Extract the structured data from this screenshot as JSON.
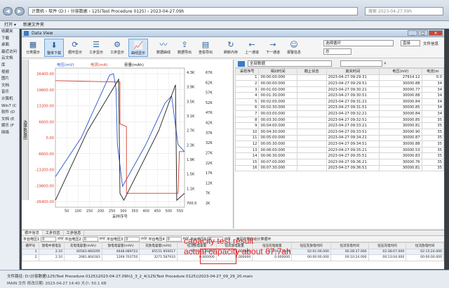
{
  "explorer": {
    "address": "计算机 › 软件 (D:) › 分容数据 › 125(Test Procedure 0125) › 2023-04-27.09h",
    "search_placeholder": "搜索 2023-04-27.09h",
    "menu": [
      "打开 ▾",
      "新建文件夹"
    ]
  },
  "sidebar": {
    "items": [
      "收藏夹",
      "下载",
      "桌面",
      "最近访问",
      "云文档",
      "库",
      "视频",
      "图片",
      "文档",
      "音乐",
      "计算机",
      "Win7 (C",
      "软件 (D",
      "文档 (E",
      "娱乐 (F",
      "网络"
    ]
  },
  "window": {
    "title": "Data View"
  },
  "toolbar": {
    "buttons": [
      {
        "label": "分类展示",
        "icon": "▦"
      },
      {
        "label": "整体下载",
        "icon": "⬇"
      },
      {
        "label": "循环显示",
        "icon": "⟳"
      },
      {
        "label": "工步显示",
        "icon": "☰"
      },
      {
        "label": "工序显示",
        "icon": "⚙"
      },
      {
        "label": "曲线显示",
        "icon": "📈"
      },
      {
        "label": "数据曲线",
        "icon": "〰"
      },
      {
        "label": "数据导出",
        "icon": "⇪"
      },
      {
        "label": "查看导出",
        "icon": "▤"
      },
      {
        "label": "刷新内存",
        "icon": "↻"
      },
      {
        "label": "上一通道",
        "icon": "←"
      },
      {
        "label": "下一通道",
        "icon": "→"
      },
      {
        "label": "报警信息",
        "icon": "☺"
      }
    ],
    "combo1": "选择循环",
    "combo2": "总",
    "combo3": "直接",
    "file_info": "文件信息"
  },
  "chart_data": {
    "type": "line",
    "legend_labels": [
      "电压(mV)",
      "电流(mA)",
      "容量(mAh)"
    ],
    "left_ticks_voltage": [
      "26400.00",
      "19800.00",
      "13200.00",
      "6600.00",
      "0.00",
      "-6600.00",
      "-13200.00",
      "-19800.00",
      "-26400.00"
    ],
    "right_ticks_capacity": [
      "4.3K",
      "3.9K",
      "3.5K",
      "3.1K",
      "2.7K",
      "2.3K",
      "1.9K",
      "1.5K",
      "1.1K",
      "700.0"
    ],
    "right_ticks_energy": [
      "67K",
      "62K",
      "57K",
      "52K",
      "47K",
      "42K",
      "37K",
      "32K",
      "27K",
      "22K",
      "17K",
      "12K",
      "7K",
      "2K"
    ],
    "x_ticks": [
      "50",
      "100",
      "150",
      "200",
      "250",
      "300",
      "350",
      "400",
      "450",
      "500",
      "550"
    ],
    "xlabel": "采样序号",
    "ylim": [
      -26400,
      26400
    ],
    "xlim": [
      0,
      570
    ]
  },
  "vertical_tab": "选择数据图",
  "right_table": {
    "header_combo": "全部数据",
    "columns": [
      "采样序号",
      "相对时间",
      "截止状态",
      "真实时间",
      "电压(mV)",
      "电流(m"
    ],
    "rows": [
      [
        "1",
        "00:00:00.000",
        "",
        "2023-04-27 09:29:31",
        "27914.12",
        "0.0"
      ],
      [
        "2",
        "00:00:00.000",
        "",
        "2023-04-27 09:29:51",
        "30000.88",
        "34"
      ],
      [
        "3",
        "00:01:00.000",
        "",
        "2023-04-27 09:30:21",
        "30000.77",
        "34"
      ],
      [
        "4",
        "00:01:30.000",
        "",
        "2023-04-27 09:30:51",
        "30000.88",
        "34"
      ],
      [
        "5",
        "00:02:00.000",
        "",
        "2023-04-27 09:31:21",
        "30000.84",
        "34"
      ],
      [
        "6",
        "00:02:30.000",
        "",
        "2023-04-27 09:31:51",
        "30000.85",
        "34"
      ],
      [
        "7",
        "00:03:00.000",
        "",
        "2023-04-27 09:32:21",
        "30000.84",
        "34"
      ],
      [
        "8",
        "00:03:30.000",
        "",
        "2023-04-27 09:32:51",
        "30000.85",
        "35"
      ],
      [
        "9",
        "00:04:00.000",
        "",
        "2023-04-27 09:33:21",
        "30000.81",
        "35"
      ],
      [
        "10",
        "00:04:30.000",
        "",
        "2023-04-27 09:33:51",
        "30000.90",
        "35"
      ],
      [
        "11",
        "00:05:00.000",
        "",
        "2023-04-27 09:34:21",
        "30000.87",
        "35"
      ],
      [
        "12",
        "00:05:30.000",
        "",
        "2023-04-27 09:34:51",
        "30000.88",
        "35"
      ],
      [
        "13",
        "00:06:00.000",
        "",
        "2023-04-27 09:35:21",
        "30000.53",
        "35"
      ],
      [
        "14",
        "00:06:30.000",
        "",
        "2023-04-27 09:35:51",
        "30000.83",
        "35"
      ],
      [
        "15",
        "00:07:00.000",
        "",
        "2023-04-27 09:36:21",
        "30000.76",
        "35"
      ],
      [
        "16",
        "00:07:30.000",
        "",
        "2023-04-27 09:36:51",
        "30000.81",
        "35"
      ]
    ]
  },
  "bottom": {
    "tabs": [
      "循环信息",
      "工步日志",
      "工步信息"
    ],
    "filters": [
      "平台电压1",
      "0",
      "mV",
      "平台电压2",
      "0",
      "mV",
      "平台电压3",
      "0",
      "mV",
      "平台电压4",
      "0",
      "mV",
      "平台电压5",
      "0",
      "mV",
      "满足容量自动计算循环"
    ],
    "columns": [
      "循环号",
      "放电中值电压",
      "充电电容量(mAh)",
      "放电电容量(mAh)",
      "充放电容量(mAh)",
      "恒流放电容量",
      "恒流放电能量",
      "恒压充电能量",
      "恒压充放电时间",
      "恒流充电时间",
      "恒压充电时间",
      "恒流放电时间"
    ],
    "rows": [
      [
        "1",
        "2.10",
        "60583.860295",
        "4648.089722",
        "65151.950017",
        "67704.139490",
        "0.000000",
        "67704.13949",
        "02:01:00.000",
        "00:28:37.000",
        "02:38:07.000",
        "02:15:24.000"
      ],
      [
        "2",
        "2.10",
        "2081.804183",
        "1269.703750",
        "3271.587933",
        "0.000000",
        "0.000000",
        "0.000000",
        "00:00:00.000",
        "00:10:24.000",
        "00:13:04.000",
        "00:00:00.000"
      ]
    ]
  },
  "annotations": {
    "line1": "capacity test result",
    "line2": "actual capacity about 67.7ah"
  },
  "status": {
    "file_path": "文件路径: D:\\分容数据\\125(Test Procedure 0125)\\2023-04-27.09h\\1_3_2_4(125(Test Procedure 0125))2023-04-27_09_29_20.main",
    "details": "MAIN 文件    修改日期: 2023-04-27 14:40    大小: 50.1 KB"
  },
  "colors": {
    "voltage": "#2b54c8",
    "current": "#d83a2a",
    "capacity": "#1c1c1c",
    "annotation": "#e32222"
  }
}
